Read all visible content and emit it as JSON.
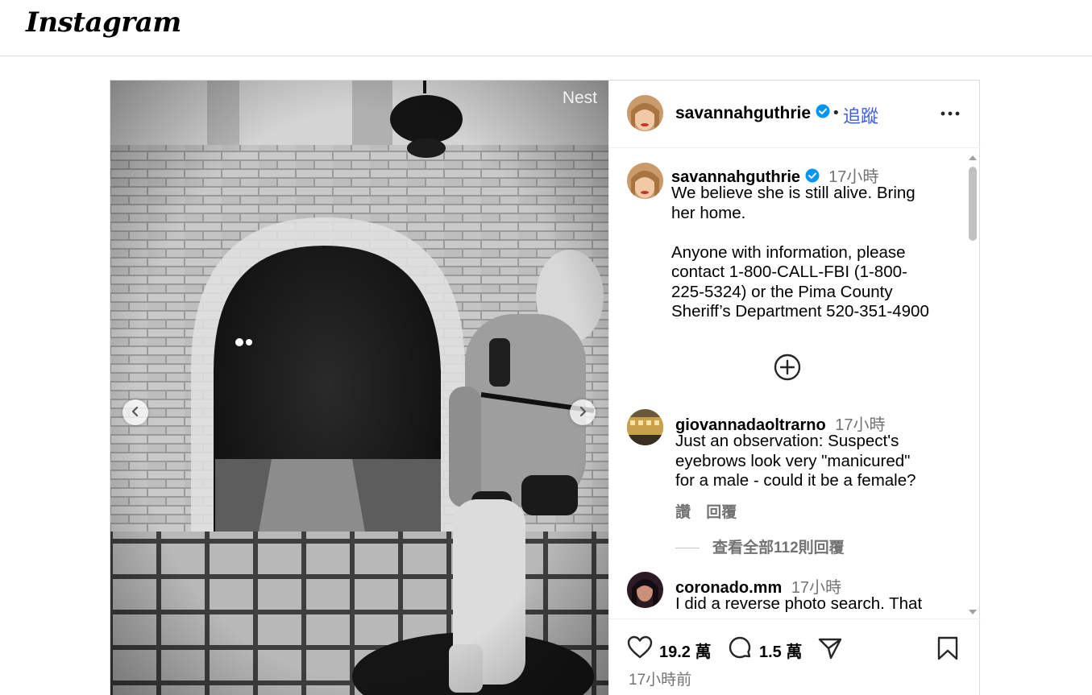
{
  "app": {
    "logo": "Instagram"
  },
  "media": {
    "watermark": "Nest",
    "prev_icon": "chevron-left-icon",
    "next_icon": "chevron-right-icon"
  },
  "header": {
    "username": "savannahguthrie",
    "separator": "•",
    "follow_label": "追蹤",
    "more_icon": "more-horizontal-icon"
  },
  "caption": {
    "username": "savannahguthrie",
    "time": "17小時",
    "text": "We believe she is still alive. Bring\nher home.\n\nAnyone with information, please\ncontact 1-800-CALL-FBI (1-800-\n225-5324) or the Pima County\nSheriff’s Department 520-351-4900"
  },
  "comments": [
    {
      "username": "giovannadaoltrarno",
      "time": "17小時",
      "text": "Just an observation: Suspect's\neyebrows look very \"manicured\"\nfor a male - could it be a female?",
      "like_label": "讚",
      "reply_label": "回覆",
      "view_replies": "查看全部112則回覆"
    },
    {
      "username": "coronado.mm",
      "time": "17小時",
      "text": "I did a reverse photo search. That"
    }
  ],
  "actions": {
    "like_icon": "heart-icon",
    "likes": "19.2 萬",
    "comment_icon": "comment-icon",
    "comments_count": "1.5 萬",
    "share_icon": "send-icon",
    "save_icon": "bookmark-icon",
    "posted": "17小時前"
  },
  "colors": {
    "verified": "#0095f6",
    "follow": "#3c5fd6",
    "secondary_text": "#737373",
    "border": "#dbdbdb"
  }
}
